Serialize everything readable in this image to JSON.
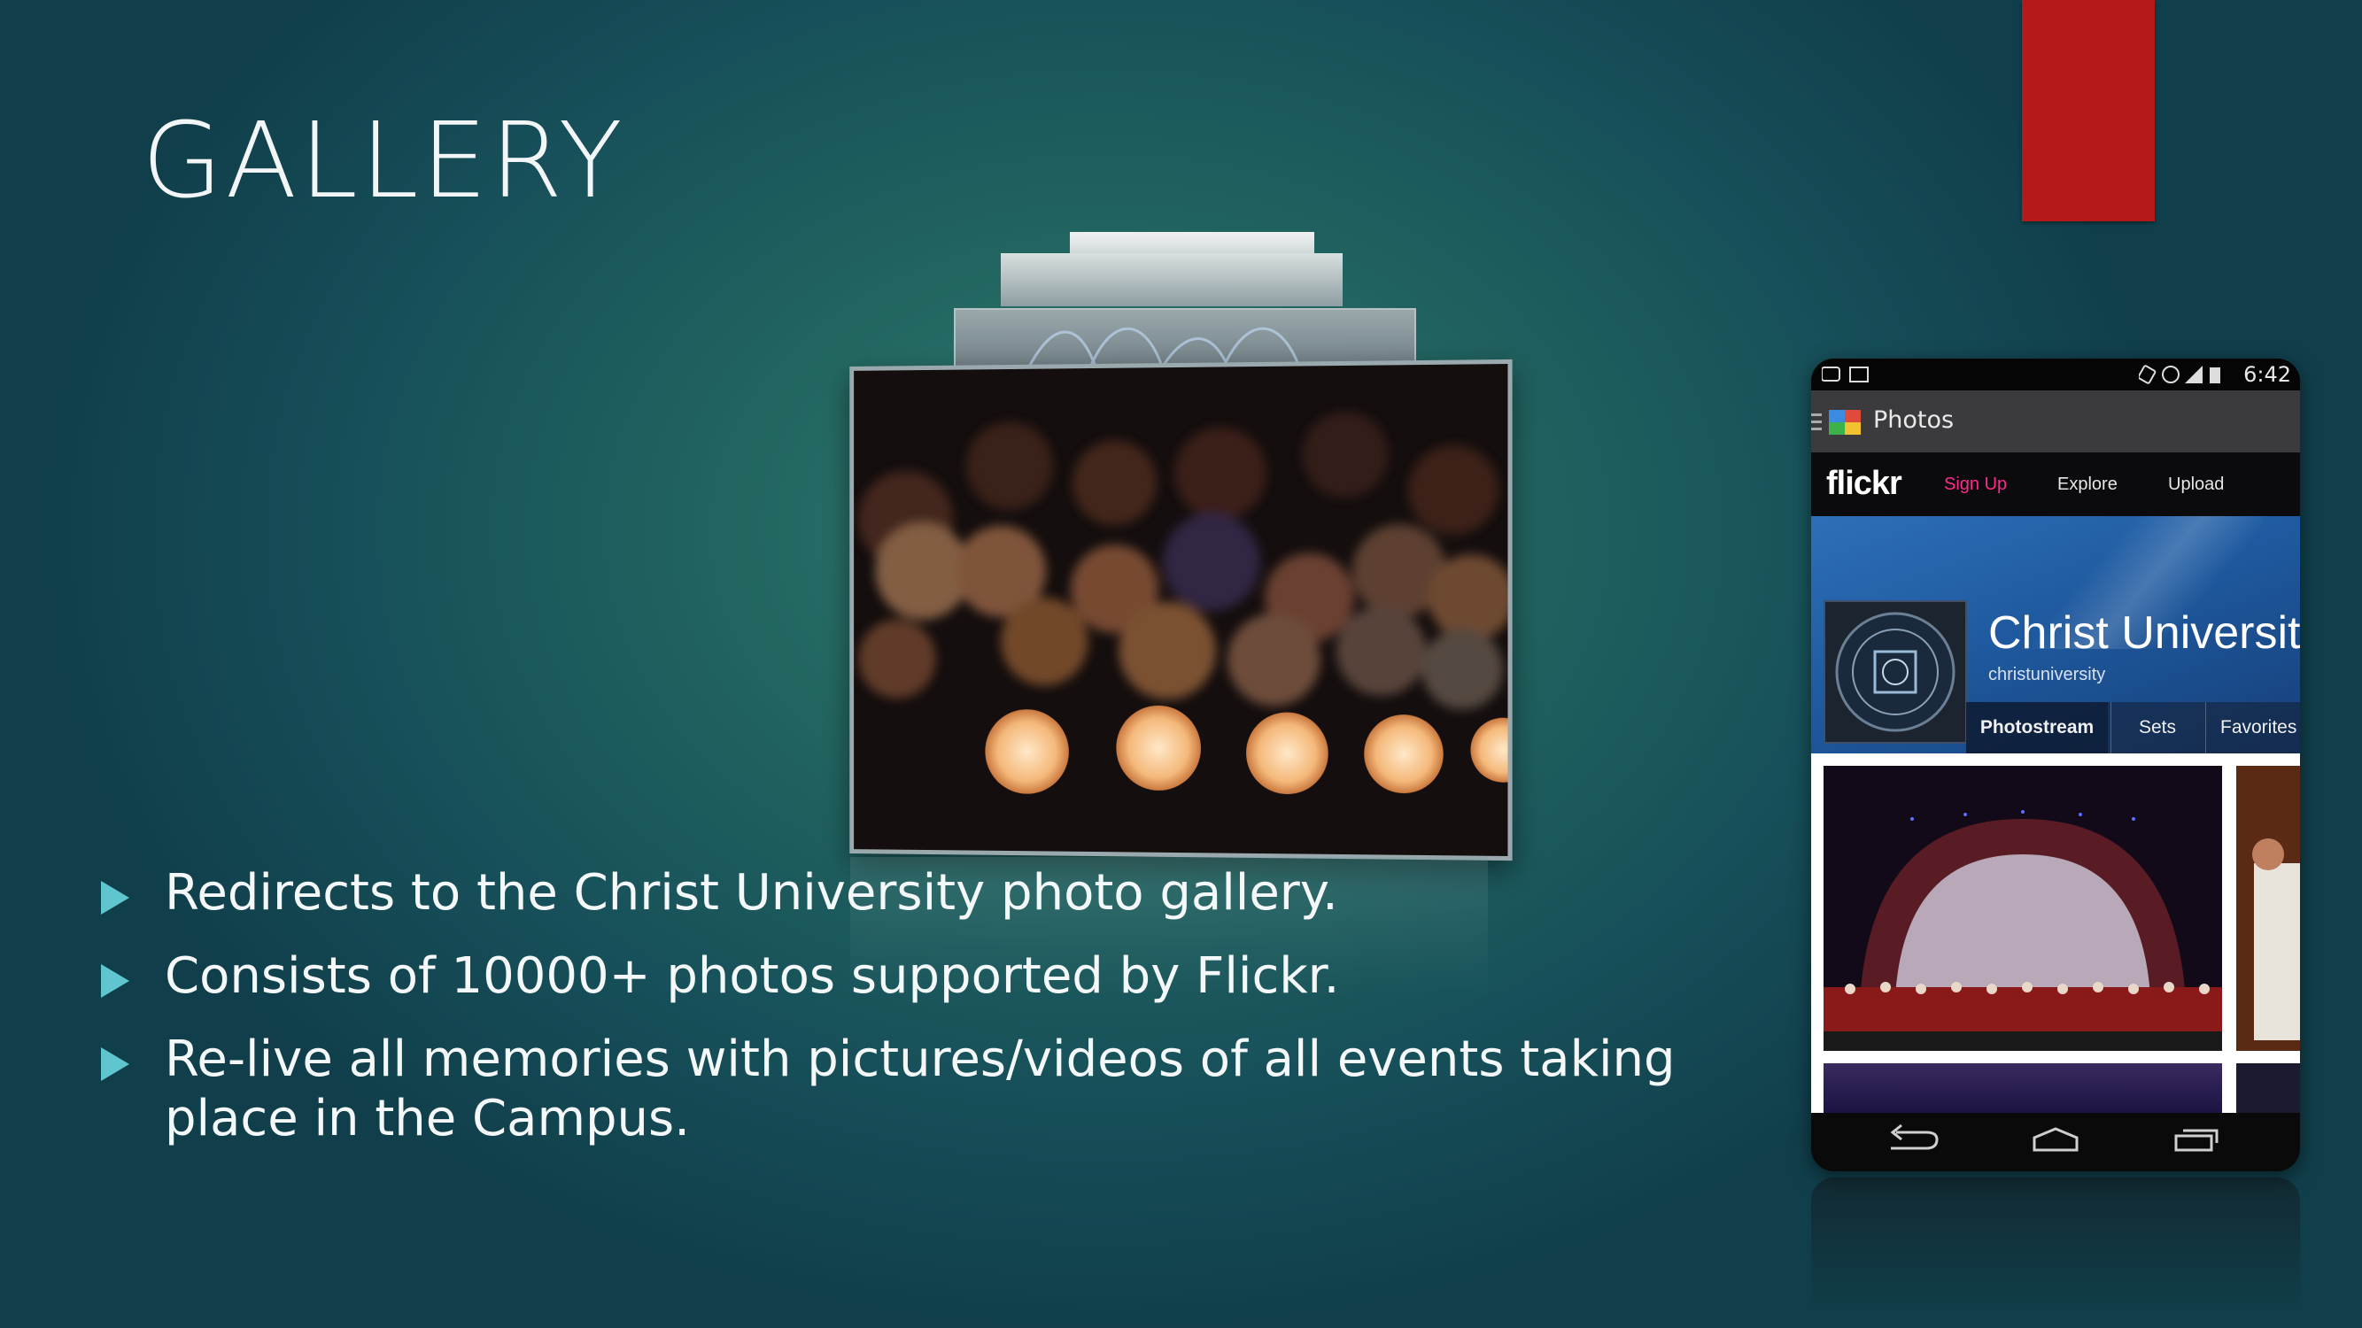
{
  "slide": {
    "title": "GALLERY",
    "accent_color": "#b5191a",
    "bullet_color": "#5fc6d0"
  },
  "bullets": [
    "Redirects to the Christ University photo gallery.",
    "Consists of 10000+ photos supported by Flickr.",
    "Re-live all memories with pictures/videos of all events taking place in the Campus."
  ],
  "phone": {
    "status_time": "6:42",
    "app_title": "Photos",
    "flickr": {
      "logo": "flickr",
      "nav": {
        "signup": "Sign Up",
        "explore": "Explore",
        "upload": "Upload"
      },
      "profile": {
        "name": "Christ University",
        "handle": "christuniversity"
      },
      "tabs": {
        "photostream": "Photostream",
        "sets": "Sets",
        "favorites": "Favorites"
      }
    },
    "icons": {
      "status_left": [
        "message-icon",
        "image-icon"
      ],
      "status_right": [
        "rotate-icon",
        "alarm-icon",
        "signal-icon",
        "battery-icon"
      ],
      "app": [
        "menu-icon",
        "photos-app-icon"
      ],
      "nav": [
        "back-icon",
        "home-icon",
        "recent-apps-icon"
      ]
    }
  }
}
